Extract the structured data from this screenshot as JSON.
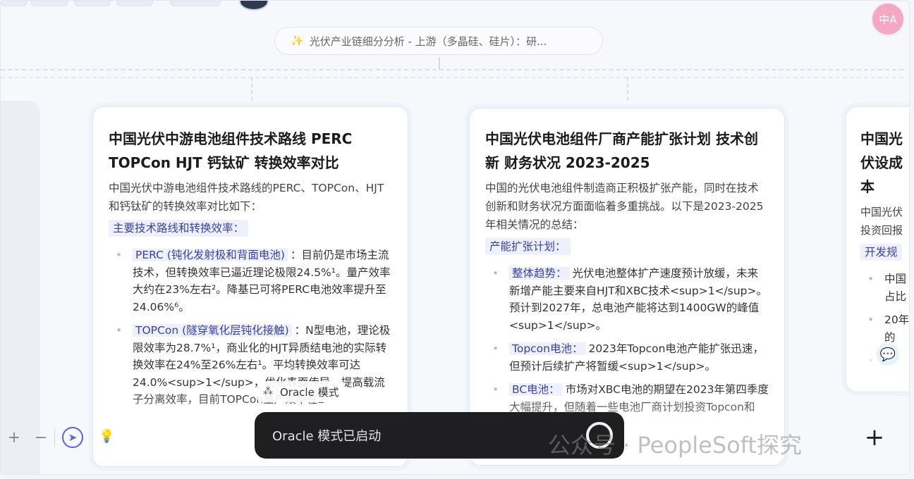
{
  "breadcrumb": {
    "icon": "sparkle-icon",
    "text": "光伏产业链细分分析 - 上游（多晶硅、硅片）：研..."
  },
  "cards": [
    {
      "title": "中国光伏中游电池组件技术路线 PERC TOPCon HJT 钙钛矿 转换效率对比",
      "intro": "中国光伏中游电池组件技术路线的PERC、TOPCon、HJT和钙钛矿的转换效率对比如下：",
      "section": "主要技术路线和转换效率：",
      "items": [
        {
          "label": "PERC (钝化发射极和背面电池)",
          "text": "：目前仍是市场主流技术，但转换效率已逼近理论极限24.5%¹。量产效率大约在23%左右²。降基已可将PERC电池效率提升至 24.06%⁶。"
        },
        {
          "label": "TOPCon (隧穿氧化层钝化接触)",
          "text": "：N型电池，理论极限效率为28.7%¹，商业化的HJT异质结电池的实际转换效率在24%至26%左右¹。平均转换效率可达24.0%<sup>1</sup>，优化表面传导，提高载流子分离效率，目前TOPCon量产效率在2"
        }
      ]
    },
    {
      "title": "中国光伏电池组件厂商产能扩张计划 技术创新 财务状况 2023-2025",
      "intro": "中国的光伏电池组件制造商正积极扩张产能，同时在技术创新和财务状况方面面临着多重挑战。以下是2023-2025年相关情况的总结：",
      "section": "产能扩张计划：",
      "items": [
        {
          "label": "整体趋势：",
          "text": "光伏电池整体扩产速度预计放缓，未来新增产能主要来自HJT和XBC技术<sup>1</sup>。预计到2027年，总电池产能将达到1400GW的峰值<sup>1</sup>。"
        },
        {
          "label": "Topcon电池：",
          "text": "2023年Topcon电池产能扩张迅速，但预计后续扩产将暂缓<sup>1</sup>。"
        },
        {
          "label": "BC电池：",
          "text": "市场对XBC电池的期望在2023年第四季度大幅提升，但随着一些电池厂商计划投资Topcon和HJT电池产"
        }
      ]
    },
    {
      "title": "中国光伏设成本",
      "intro": "中国光伏投资回报",
      "section": "开发规",
      "items": [
        {
          "label": "",
          "text": "中国占比"
        },
        {
          "label": "",
          "text": "20年的"
        },
        {
          "label": "",
          "text": "中"
        }
      ]
    }
  ],
  "oracle_tooltip": {
    "icon": "oracle-sparkle-icon",
    "label": "Oracle 模式"
  },
  "toast": {
    "message": "Oracle 模式已启动"
  },
  "zoom": {
    "plus": "+",
    "minus": "−"
  },
  "watermark": {
    "text": "公众号 · PeopleSoft探究"
  },
  "translate_button": {
    "label": "中A"
  },
  "plus_button": {
    "label": "+"
  },
  "colors": {
    "accent": "#5b63d9",
    "highlight_bg": "#eef1fb",
    "toast_bg": "#1f1f21",
    "translate_bg": "#f4a8c4"
  }
}
